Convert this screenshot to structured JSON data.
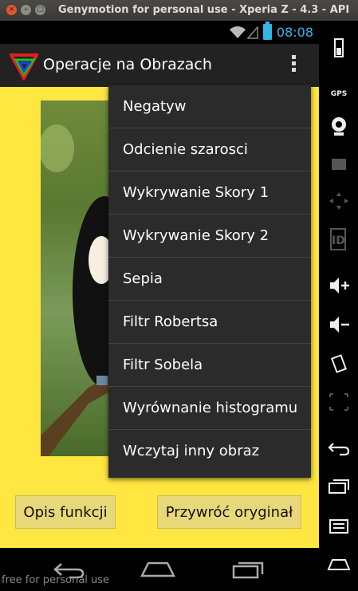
{
  "window": {
    "title": "Genymotion for personal use - Xperia Z - 4.3 - API"
  },
  "statusbar": {
    "time": "08:08",
    "icons": [
      "wifi-icon",
      "no-signal-icon",
      "battery-icon"
    ]
  },
  "actionbar": {
    "title": "Operacje na Obrazach",
    "logo": "app-logo-icon",
    "overflow": "overflow-menu-icon"
  },
  "menu": {
    "items": [
      {
        "label": "Negatyw"
      },
      {
        "label": "Odcienie szarosci"
      },
      {
        "label": "Wykrywanie Skory 1"
      },
      {
        "label": "Wykrywanie Skory 2"
      },
      {
        "label": "Sepia"
      },
      {
        "label": "Filtr Robertsa"
      },
      {
        "label": "Filtr Sobela"
      },
      {
        "label": "Wyrównanie histogramu"
      },
      {
        "label": "Wczytaj inny obraz"
      }
    ]
  },
  "buttons": {
    "info_label": "Opis funkcji",
    "reset_label": "Przywróć oryginał"
  },
  "navbar": {
    "icons": [
      "back-icon",
      "home-icon",
      "recent-apps-icon"
    ]
  },
  "watermark": "free for personal use",
  "sidepanel": {
    "icons": [
      "battery-widget-icon",
      "gps-icon",
      "camera-icon",
      "video-icon",
      "dpad-icon",
      "id-icon",
      "volume-up-icon",
      "volume-down-icon",
      "rotate-icon",
      "scale-icon",
      "back-icon",
      "recent-apps-icon",
      "menu-icon",
      "home-icon"
    ],
    "gps_label": "GPS",
    "id_label": "ID"
  },
  "colors": {
    "app_background": "#ffe640",
    "actionbar": "#222222",
    "menu_background": "#2b2b2b",
    "accent_blue": "#33b5e5",
    "button_background": "#e8d87a"
  }
}
